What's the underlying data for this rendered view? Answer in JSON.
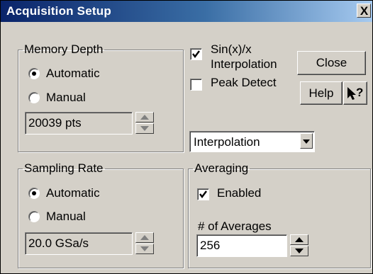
{
  "window": {
    "title": "Acquisition Setup",
    "close_glyph": "X"
  },
  "memory_depth": {
    "legend": "Memory Depth",
    "options": [
      "Automatic",
      "Manual"
    ],
    "selected": "Automatic",
    "value": "20039 pts"
  },
  "sampling_rate": {
    "legend": "Sampling Rate",
    "options": [
      "Automatic",
      "Manual"
    ],
    "selected": "Automatic",
    "value": "20.0 GSa/s"
  },
  "sinx": {
    "label_line1": "Sin(x)/x",
    "label_line2": "Interpolation",
    "checked": true
  },
  "peak_detect": {
    "label": "Peak Detect",
    "checked": false
  },
  "buttons": {
    "close": "Close",
    "help": "Help",
    "whats_this": "?"
  },
  "mode_select": {
    "value": "Interpolation"
  },
  "averaging": {
    "legend": "Averaging",
    "enabled_label": "Enabled",
    "enabled_checked": true,
    "count_label": "# of Averages",
    "count_value": "256"
  }
}
